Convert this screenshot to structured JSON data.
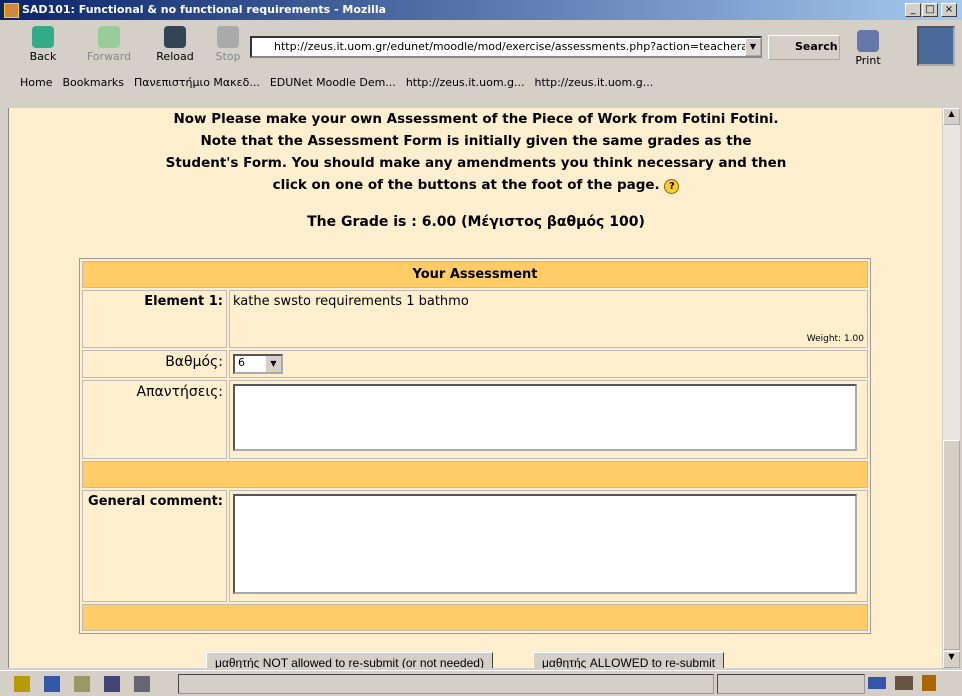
{
  "window": {
    "title": "SAD101: Functional & no functional requirements - Mozilla"
  },
  "toolbar": {
    "back": "Back",
    "forward": "Forward",
    "reload": "Reload",
    "stop": "Stop",
    "url": "http://zeus.it.uom.gr/edunet/moodle/mod/exercise/assessments.php?action=teacherassessment",
    "search": "Search",
    "print": "Print"
  },
  "bookmarks": [
    "Home",
    "Bookmarks",
    "Πανεπιστήμιο Μακεδ...",
    "EDUNet Moodle Dem...",
    "http://zeus.it.uom.g...",
    "http://zeus.it.uom.g..."
  ],
  "intro": {
    "line1": "Now Please make your own Assessment of the Piece of Work from Fotini Fotini.",
    "line2": "Note that the Assessment Form is initially given the same grades as the",
    "line3": "Student's Form. You should make any amendments you think necessary and then",
    "line4": "click on one of the buttons at the foot of the page.",
    "grade": "The Grade is : 6.00 (Μέγιστος βαθμός 100)"
  },
  "form": {
    "header": "Your Assessment",
    "element_label": "Element 1:",
    "element_text": "kathe swsto requirements 1 bathmo",
    "weight": "Weight: 1.00",
    "grade_label": "Βαθμός:",
    "grade_value": "6",
    "answers_label": "Απαντήσεις:",
    "answers_value": "",
    "general_label": "General comment:",
    "general_value": ""
  },
  "buttons": {
    "not_allowed": "μαθητής NOT allowed to re-submit (or not needed)",
    "allowed": "μαθητής ALLOWED to re-submit"
  }
}
